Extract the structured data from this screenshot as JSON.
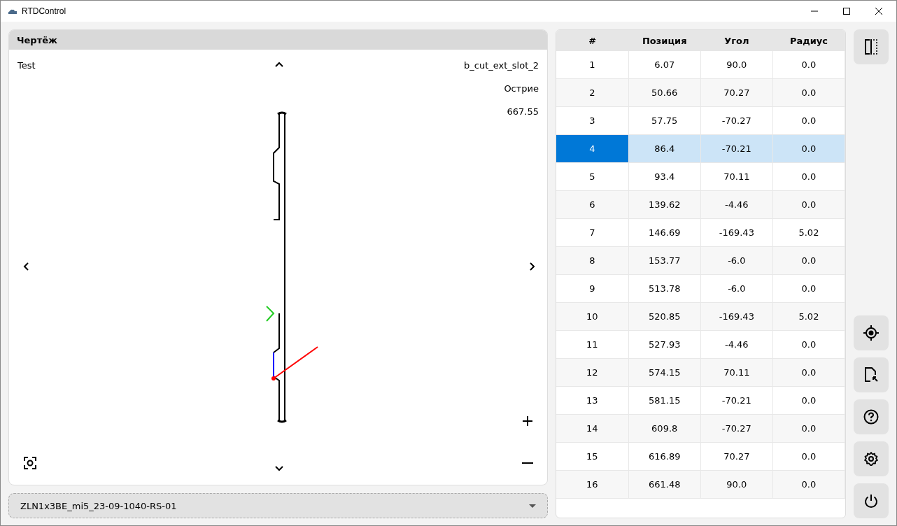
{
  "window": {
    "title": "RTDControl"
  },
  "drawing_panel": {
    "title": "Чертёж",
    "name": "Test",
    "profile": "b_cut_ext_slot_2",
    "tool": "Острие",
    "value": "667.55"
  },
  "profile_select": {
    "value": "ZLN1x3BE_mi5_23-09-1040-RS-01"
  },
  "table": {
    "columns": [
      "#",
      "Позиция",
      "Угол",
      "Радиус"
    ],
    "rows": [
      {
        "cells": [
          "1",
          "6.07",
          "90.0",
          "0.0"
        ],
        "selected": false
      },
      {
        "cells": [
          "2",
          "50.66",
          "70.27",
          "0.0"
        ],
        "selected": false
      },
      {
        "cells": [
          "3",
          "57.75",
          "-70.27",
          "0.0"
        ],
        "selected": false
      },
      {
        "cells": [
          "4",
          "86.4",
          "-70.21",
          "0.0"
        ],
        "selected": true
      },
      {
        "cells": [
          "5",
          "93.4",
          "70.11",
          "0.0"
        ],
        "selected": false
      },
      {
        "cells": [
          "6",
          "139.62",
          "-4.46",
          "0.0"
        ],
        "selected": false
      },
      {
        "cells": [
          "7",
          "146.69",
          "-169.43",
          "5.02"
        ],
        "selected": false
      },
      {
        "cells": [
          "8",
          "153.77",
          "-6.0",
          "0.0"
        ],
        "selected": false
      },
      {
        "cells": [
          "9",
          "513.78",
          "-6.0",
          "0.0"
        ],
        "selected": false
      },
      {
        "cells": [
          "10",
          "520.85",
          "-169.43",
          "5.02"
        ],
        "selected": false
      },
      {
        "cells": [
          "11",
          "527.93",
          "-4.46",
          "0.0"
        ],
        "selected": false
      },
      {
        "cells": [
          "12",
          "574.15",
          "70.11",
          "0.0"
        ],
        "selected": false
      },
      {
        "cells": [
          "13",
          "581.15",
          "-70.21",
          "0.0"
        ],
        "selected": false
      },
      {
        "cells": [
          "14",
          "609.8",
          "-70.27",
          "0.0"
        ],
        "selected": false
      },
      {
        "cells": [
          "15",
          "616.89",
          "70.27",
          "0.0"
        ],
        "selected": false
      },
      {
        "cells": [
          "16",
          "661.48",
          "90.0",
          "0.0"
        ],
        "selected": false
      }
    ]
  }
}
